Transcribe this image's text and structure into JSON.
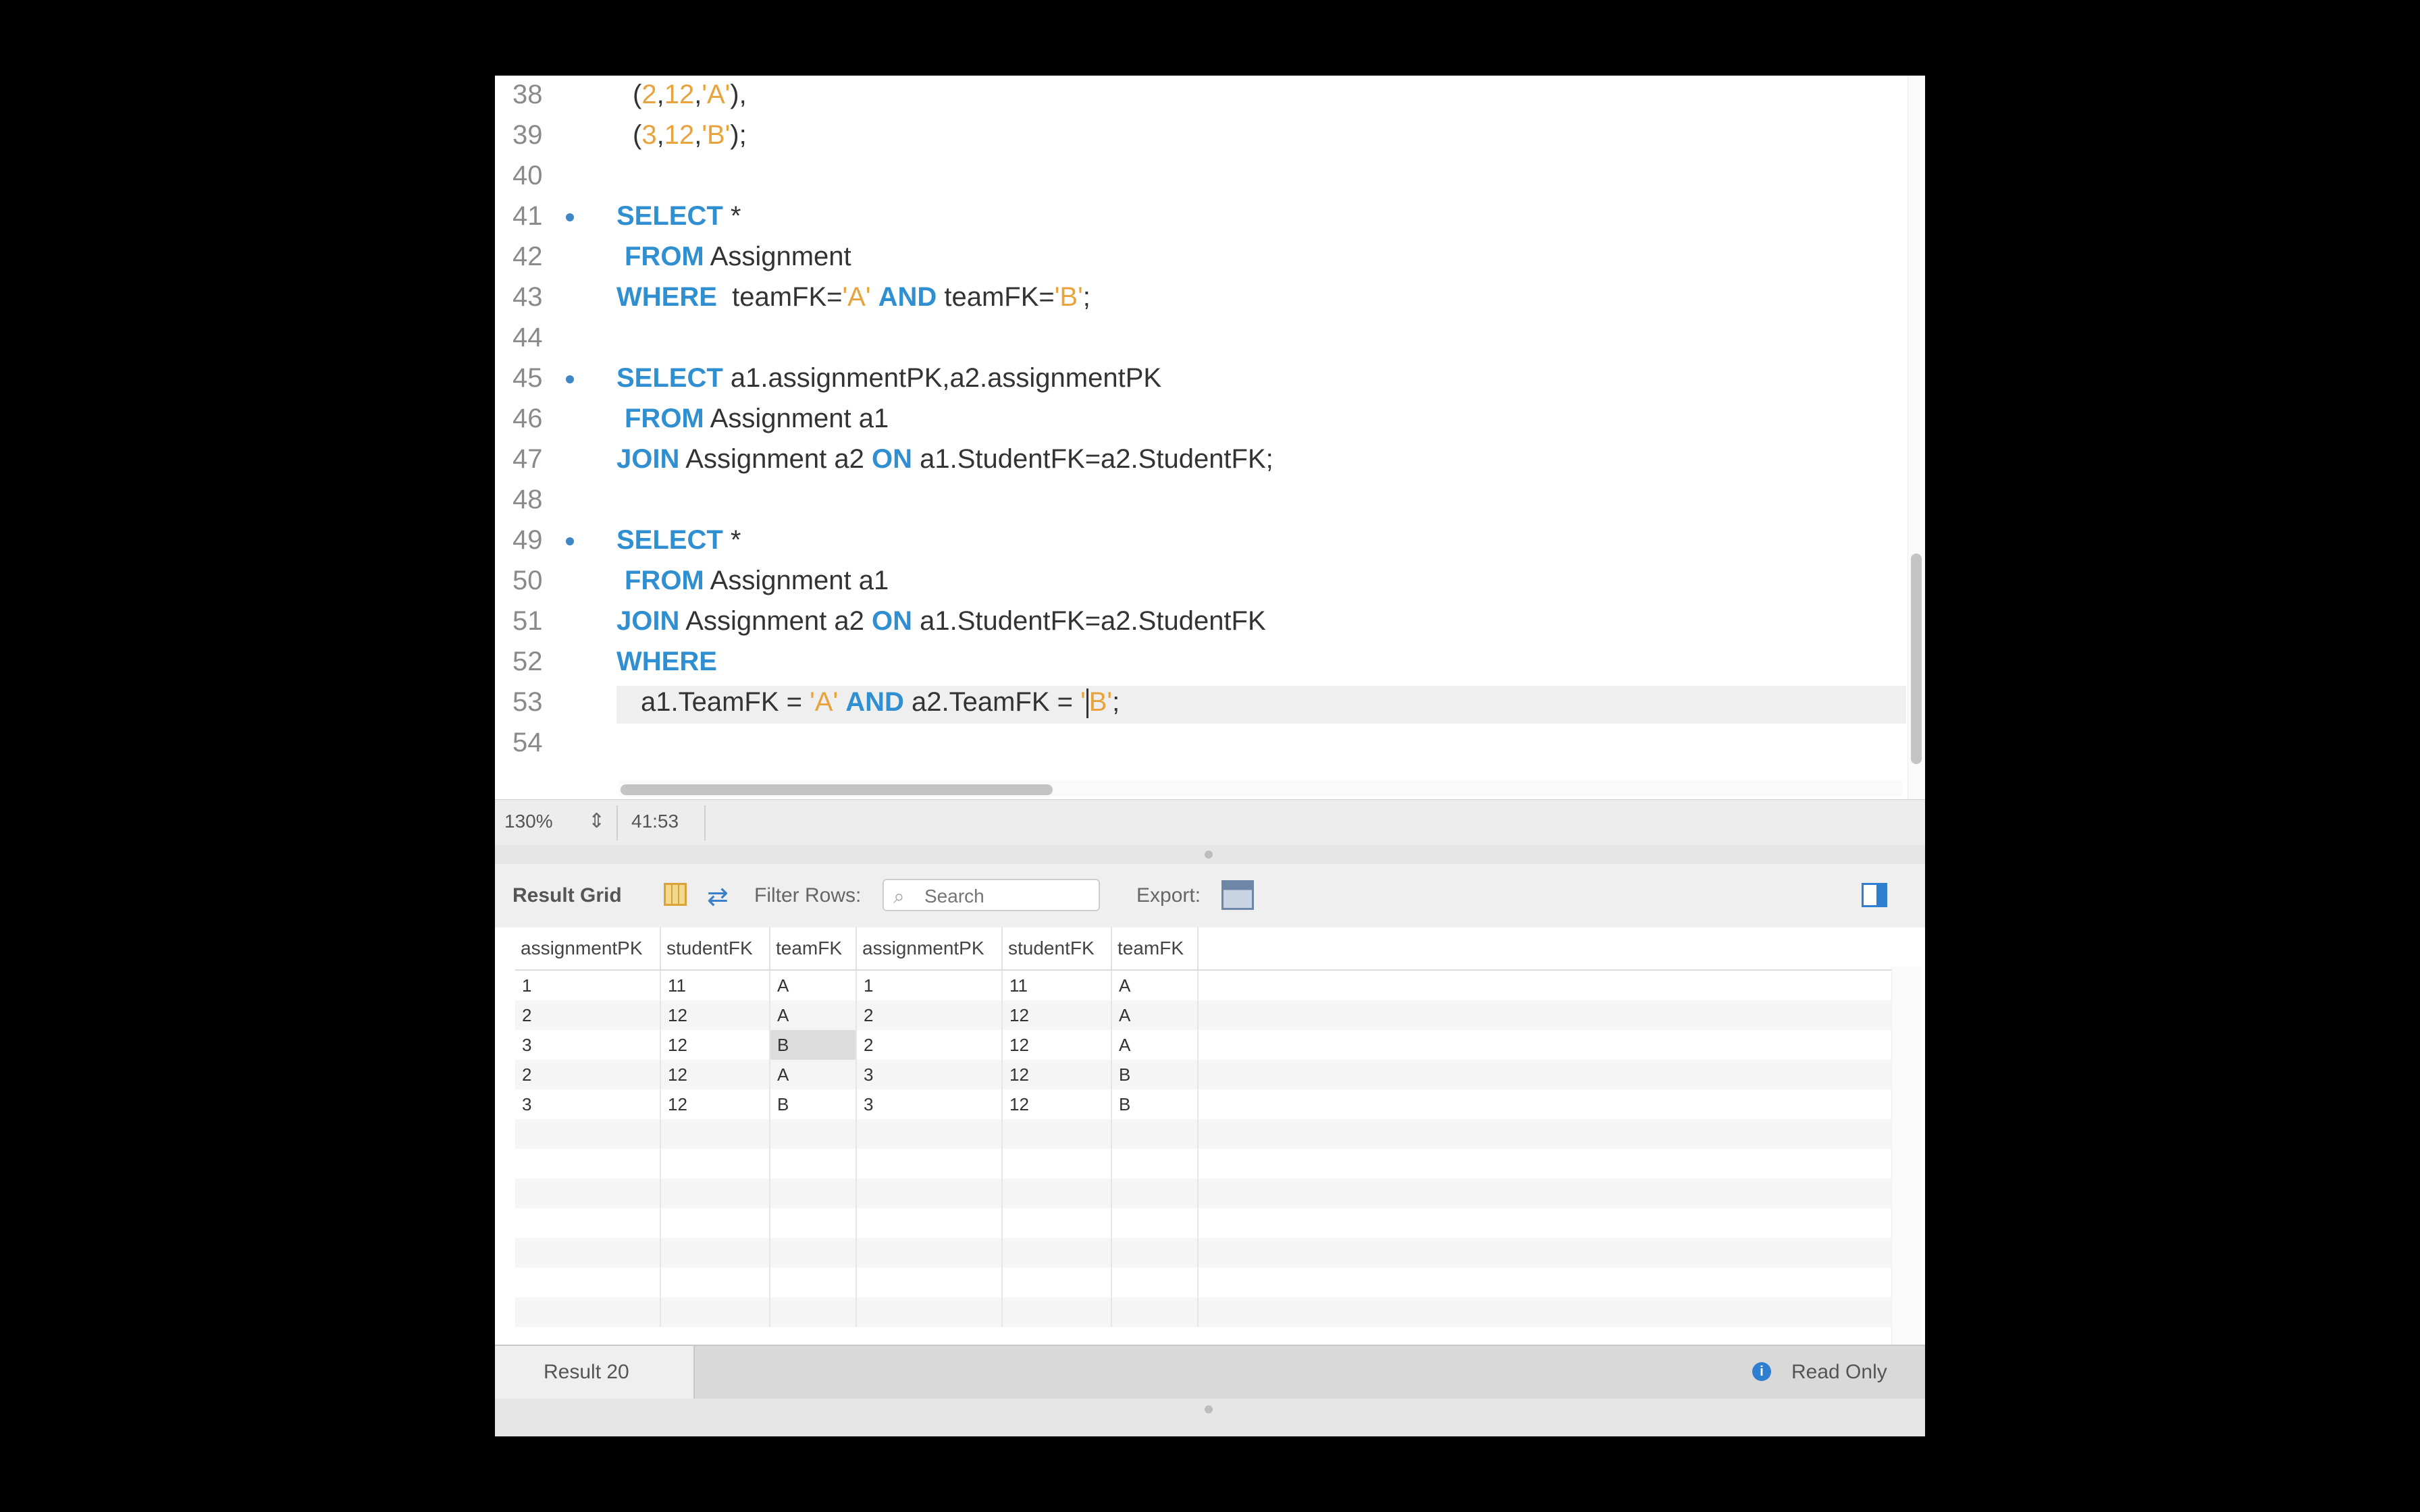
{
  "editor": {
    "lines": [
      {
        "n": "38",
        "dot": false,
        "indent": 2,
        "tokens": [
          {
            "t": "("
          },
          {
            "t": "2",
            "c": "str"
          },
          {
            "t": ","
          },
          {
            "t": "12",
            "c": "str"
          },
          {
            "t": ","
          },
          {
            "t": "'A'",
            "c": "str"
          },
          {
            "t": "),"
          }
        ]
      },
      {
        "n": "39",
        "dot": false,
        "indent": 2,
        "tokens": [
          {
            "t": "("
          },
          {
            "t": "3",
            "c": "str"
          },
          {
            "t": ","
          },
          {
            "t": "12",
            "c": "str"
          },
          {
            "t": ","
          },
          {
            "t": "'B'",
            "c": "str"
          },
          {
            "t": ");"
          }
        ]
      },
      {
        "n": "40",
        "dot": false,
        "indent": 0,
        "tokens": []
      },
      {
        "n": "41",
        "dot": true,
        "indent": 0,
        "tokens": [
          {
            "t": "SELECT",
            "c": "kw"
          },
          {
            "t": " *"
          }
        ]
      },
      {
        "n": "42",
        "dot": false,
        "indent": 1,
        "tokens": [
          {
            "t": "FROM",
            "c": "kw"
          },
          {
            "t": " Assignment"
          }
        ]
      },
      {
        "n": "43",
        "dot": false,
        "indent": 0,
        "tokens": [
          {
            "t": "WHERE",
            "c": "kw"
          },
          {
            "t": "  teamFK="
          },
          {
            "t": "'A'",
            "c": "str"
          },
          {
            "t": " "
          },
          {
            "t": "AND",
            "c": "kw"
          },
          {
            "t": " teamFK="
          },
          {
            "t": "'B'",
            "c": "str"
          },
          {
            "t": ";"
          }
        ]
      },
      {
        "n": "44",
        "dot": false,
        "indent": 0,
        "tokens": []
      },
      {
        "n": "45",
        "dot": true,
        "indent": 0,
        "tokens": [
          {
            "t": "SELECT",
            "c": "kw"
          },
          {
            "t": " a1.assignmentPK,a2.assignmentPK"
          }
        ]
      },
      {
        "n": "46",
        "dot": false,
        "indent": 1,
        "tokens": [
          {
            "t": "FROM",
            "c": "kw"
          },
          {
            "t": " Assignment a1"
          }
        ]
      },
      {
        "n": "47",
        "dot": false,
        "indent": 0,
        "tokens": [
          {
            "t": "JOIN",
            "c": "kw"
          },
          {
            "t": " Assignment a2 "
          },
          {
            "t": "ON",
            "c": "kw"
          },
          {
            "t": " a1.StudentFK=a2.StudentFK;"
          }
        ]
      },
      {
        "n": "48",
        "dot": false,
        "indent": 0,
        "tokens": []
      },
      {
        "n": "49",
        "dot": true,
        "indent": 0,
        "tokens": [
          {
            "t": "SELECT",
            "c": "kw"
          },
          {
            "t": " *"
          }
        ]
      },
      {
        "n": "50",
        "dot": false,
        "indent": 1,
        "tokens": [
          {
            "t": "FROM",
            "c": "kw"
          },
          {
            "t": " Assignment a1"
          }
        ]
      },
      {
        "n": "51",
        "dot": false,
        "indent": 0,
        "tokens": [
          {
            "t": "JOIN",
            "c": "kw"
          },
          {
            "t": " Assignment a2 "
          },
          {
            "t": "ON",
            "c": "kw"
          },
          {
            "t": " a1.StudentFK=a2.StudentFK"
          }
        ]
      },
      {
        "n": "52",
        "dot": false,
        "indent": 0,
        "tokens": [
          {
            "t": "WHERE",
            "c": "kw"
          }
        ]
      },
      {
        "n": "53",
        "dot": false,
        "indent": 3,
        "current": true,
        "tokens": [
          {
            "t": "a1.TeamFK = "
          },
          {
            "t": "'A'",
            "c": "str"
          },
          {
            "t": " "
          },
          {
            "t": "AND",
            "c": "kw"
          },
          {
            "t": " a2.TeamFK = "
          },
          {
            "t": "'",
            "c": "str"
          },
          {
            "t": "|",
            "c": "caret"
          },
          {
            "t": "B'",
            "c": "str"
          },
          {
            "t": ";"
          }
        ]
      },
      {
        "n": "54",
        "dot": false,
        "indent": 0,
        "tokens": []
      }
    ]
  },
  "status": {
    "zoom": "130%",
    "position": "41:53"
  },
  "results": {
    "title": "Result Grid",
    "filter_label": "Filter Rows:",
    "search_placeholder": "Search",
    "export_label": "Export:",
    "columns": [
      "assignmentPK",
      "studentFK",
      "teamFK",
      "assignmentPK",
      "studentFK",
      "teamFK"
    ],
    "rows": [
      [
        "1",
        "11",
        "A",
        "1",
        "11",
        "A"
      ],
      [
        "2",
        "12",
        "A",
        "2",
        "12",
        "A"
      ],
      [
        "3",
        "12",
        "B",
        "2",
        "12",
        "A"
      ],
      [
        "2",
        "12",
        "A",
        "3",
        "12",
        "B"
      ],
      [
        "3",
        "12",
        "B",
        "3",
        "12",
        "B"
      ]
    ],
    "tab_label": "Result 20",
    "readonly_label": "Read Only"
  }
}
